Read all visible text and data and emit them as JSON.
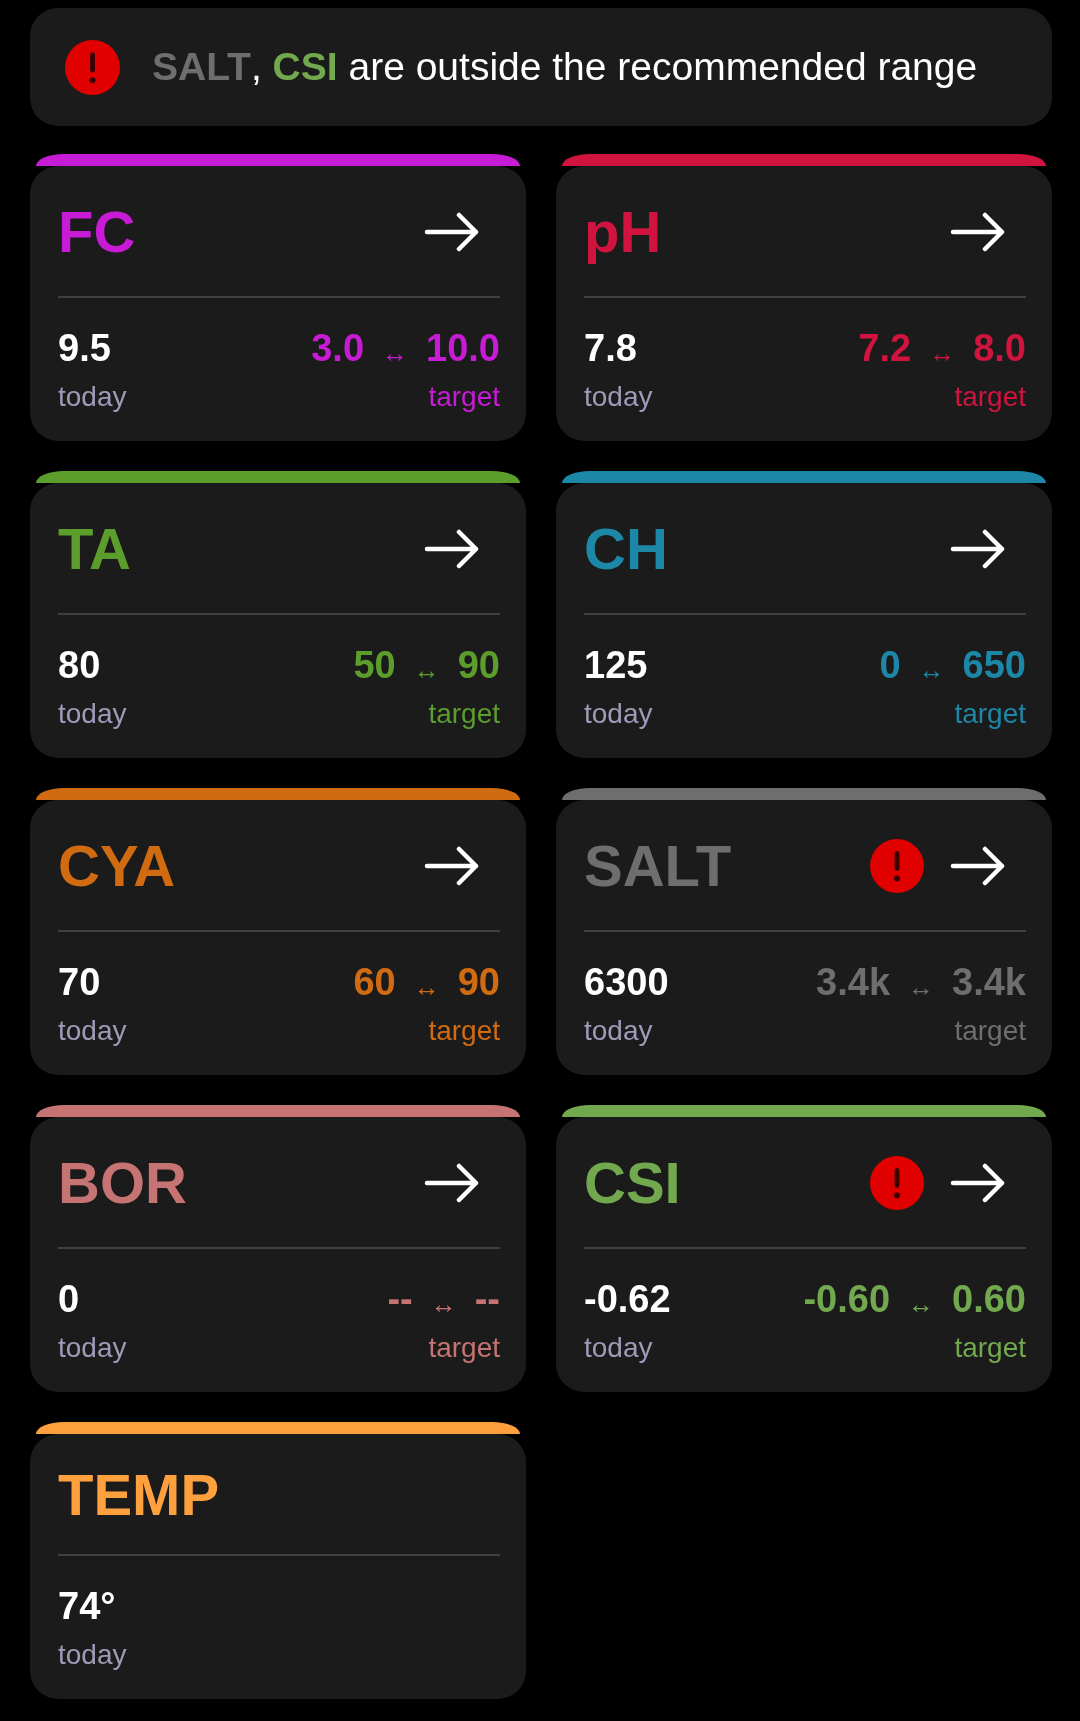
{
  "alert_banner": {
    "items": [
      {
        "name": "SALT",
        "color": "#6e6e6e",
        "after": ", "
      },
      {
        "name": "CSI",
        "color": "#72a94e",
        "after": " are outside the recommended range"
      }
    ]
  },
  "cards": [
    {
      "kind": "range",
      "name": "FC",
      "color": "#c81bd6",
      "alert": false,
      "today": {
        "value": "9.5",
        "label": "today"
      },
      "target": {
        "low": "3.0",
        "separator": "↔",
        "high": "10.0",
        "label": "target"
      }
    },
    {
      "kind": "range",
      "name": "pH",
      "color": "#d0143f",
      "alert": false,
      "today": {
        "value": "7.8",
        "label": "today"
      },
      "target": {
        "low": "7.2",
        "separator": "↔",
        "high": "8.0",
        "label": "target"
      }
    },
    {
      "kind": "range",
      "name": "TA",
      "color": "#5c9e2c",
      "alert": false,
      "today": {
        "value": "80",
        "label": "today"
      },
      "target": {
        "low": "50",
        "separator": "↔",
        "high": "90",
        "label": "target"
      }
    },
    {
      "kind": "range",
      "name": "CH",
      "color": "#1d87a8",
      "alert": false,
      "today": {
        "value": "125",
        "label": "today"
      },
      "target": {
        "low": "0",
        "separator": "↔",
        "high": "650",
        "label": "target"
      }
    },
    {
      "kind": "range",
      "name": "CYA",
      "color": "#d06b12",
      "alert": false,
      "today": {
        "value": "70",
        "label": "today"
      },
      "target": {
        "low": "60",
        "separator": "↔",
        "high": "90",
        "label": "target"
      }
    },
    {
      "kind": "range",
      "name": "SALT",
      "color": "#6e6e6e",
      "alert": true,
      "today": {
        "value": "6300",
        "label": "today"
      },
      "target": {
        "low": "3.4k",
        "separator": "↔",
        "high": "3.4k",
        "label": "target"
      }
    },
    {
      "kind": "range",
      "name": "BOR",
      "color": "#c67373",
      "alert": false,
      "today": {
        "value": "0",
        "label": "today"
      },
      "target": {
        "low": "--",
        "separator": "↔",
        "high": "--",
        "label": "target"
      }
    },
    {
      "kind": "range",
      "name": "CSI",
      "color": "#72a94e",
      "alert": true,
      "today": {
        "value": "-0.62",
        "label": "today"
      },
      "target": {
        "low": "-0.60",
        "separator": "↔",
        "high": "0.60",
        "label": "target"
      }
    },
    {
      "kind": "plain",
      "name": "TEMP",
      "color": "#ffa03e",
      "alert": false,
      "today": {
        "value": "74°",
        "label": "today"
      }
    }
  ]
}
